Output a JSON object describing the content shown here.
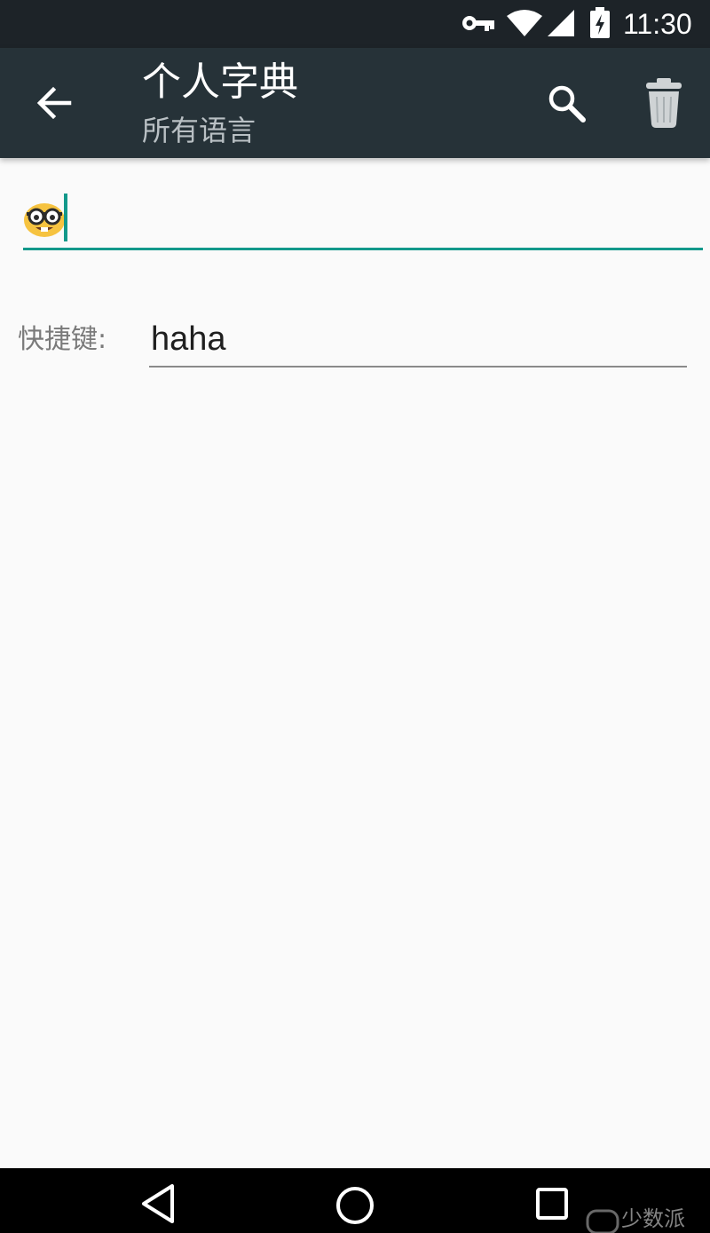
{
  "status_bar": {
    "time": "11:30",
    "icons": [
      "key-icon",
      "wifi-icon",
      "cell-signal-icon",
      "battery-charging-icon"
    ]
  },
  "app_bar": {
    "title": "个人字典",
    "subtitle": "所有语言",
    "actions": [
      "back-arrow-icon",
      "search-icon",
      "trash-icon"
    ]
  },
  "word_entry": {
    "value": "🤓",
    "accent_color": "#13998b"
  },
  "shortcut": {
    "label": "快捷键:",
    "value": "haha"
  },
  "nav_bar": {
    "buttons": [
      "back-triangle-icon",
      "home-circle-icon",
      "recents-square-icon"
    ],
    "watermark": "少数派"
  },
  "colors": {
    "status_bar": "#1d2328",
    "app_bar": "#263238",
    "background": "#fafafa",
    "accent": "#13998b"
  }
}
